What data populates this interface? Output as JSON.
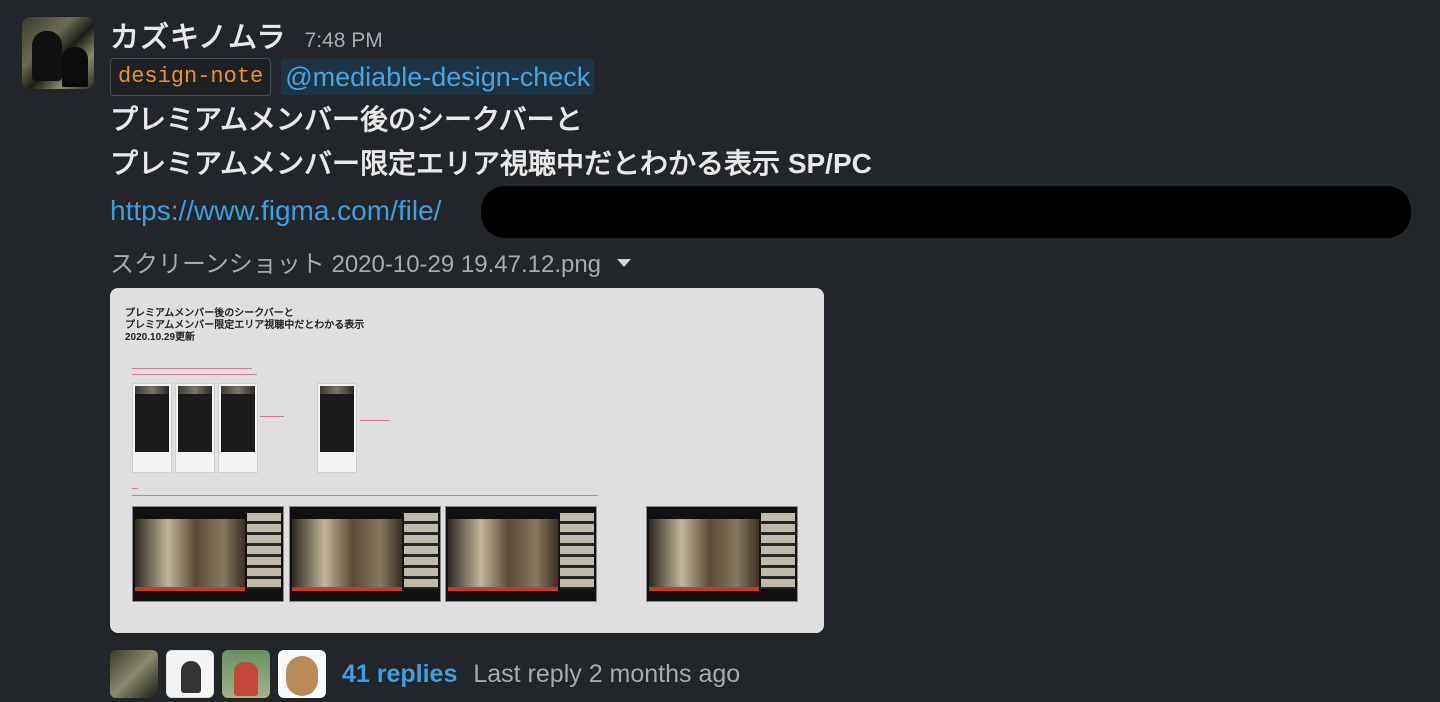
{
  "message": {
    "author": "カズキノムラ",
    "time": "7:48 PM",
    "tag_code": "design-note",
    "mention": "@mediable-design-check",
    "line1": "プレミアムメンバー後のシークバーと",
    "line2": "プレミアムメンバー限定エリア視聴中だとわかる表示 SP/PC",
    "link": "https://www.figma.com/file/",
    "attachment": {
      "file_name": "スクリーンショット 2020-10-29 19.47.12.png",
      "preview_title": "プレミアムメンバー後のシークバーと\nプレミアムメンバー限定エリア視聴中だとわかる表示\n2020.10.29更新"
    },
    "thread": {
      "replies": "41 replies",
      "last_reply": "Last reply 2 months ago"
    }
  },
  "colors": {
    "background": "#222529",
    "link": "#3d9fdb",
    "code": "#e8912d",
    "mention_bg": "#1d3445"
  }
}
